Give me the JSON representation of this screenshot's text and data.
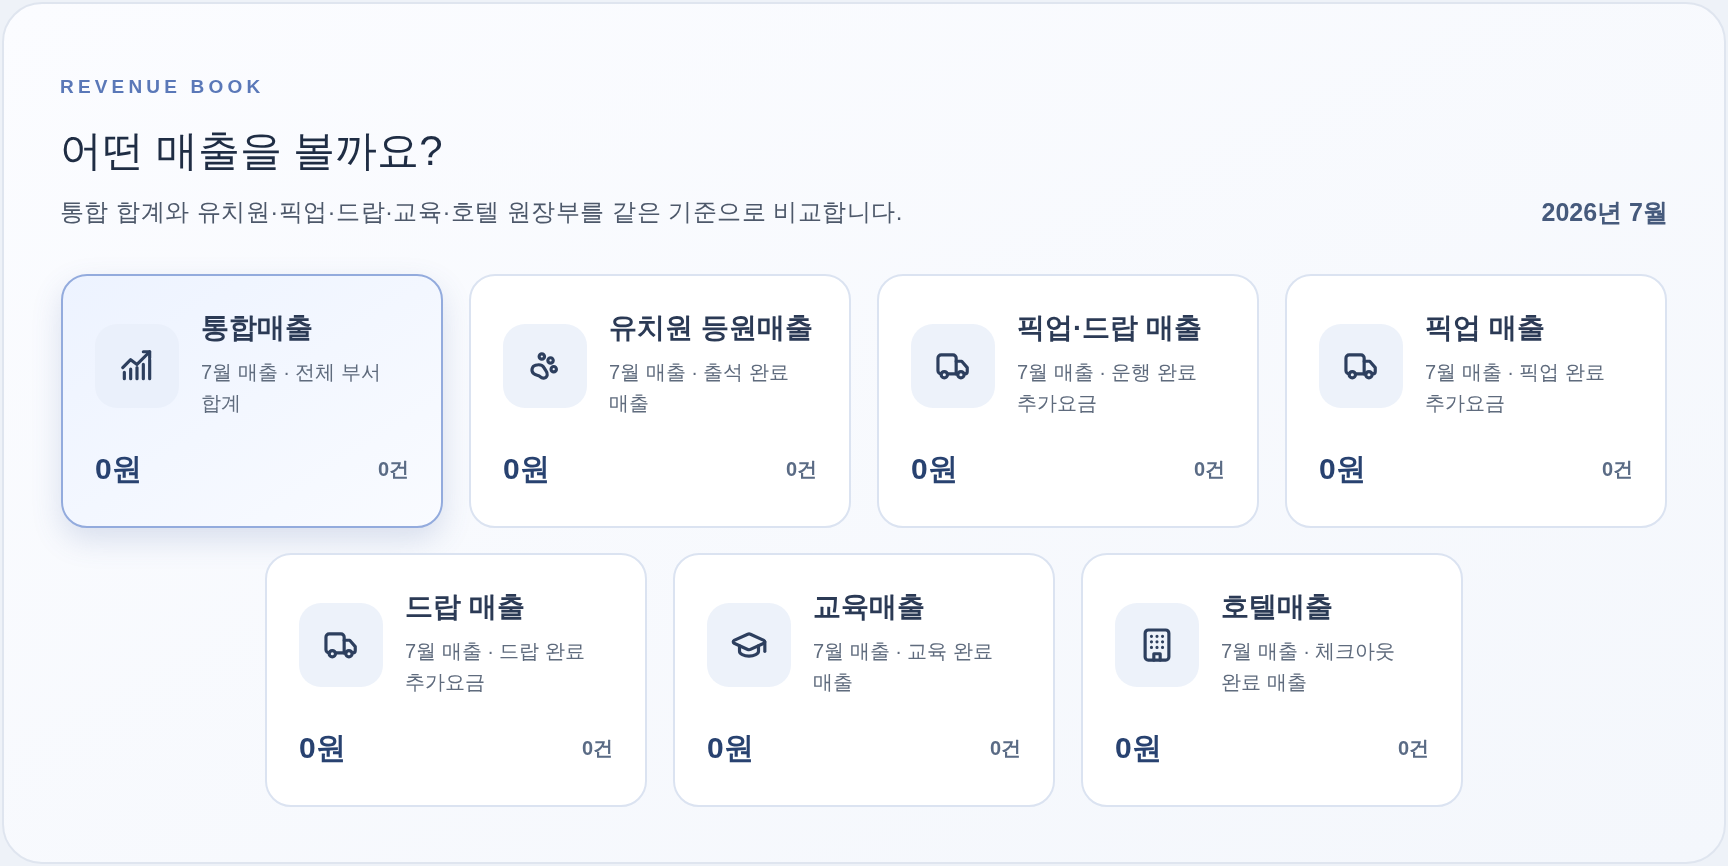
{
  "header": {
    "eyebrow": "REVENUE BOOK",
    "title": "어떤 매출을 볼까요?",
    "description": "통합 합계와 유치원·픽업·드랍·교육·호텔 원장부를 같은 기준으로 비교합니다.",
    "period": "2026년 7월"
  },
  "cards": [
    {
      "kind": "chart",
      "title": "통합매출",
      "subtitle": "7월 매출 · 전체 부서 합계",
      "amount": "0원",
      "count": "0건",
      "selected": true
    },
    {
      "kind": "paw",
      "title": "유치원 등원매출",
      "subtitle": "7월 매출 · 출석 완료 매출",
      "amount": "0원",
      "count": "0건",
      "selected": false
    },
    {
      "kind": "truck",
      "title": "픽업·드랍 매출",
      "subtitle": "7월 매출 · 운행 완료 추가요금",
      "amount": "0원",
      "count": "0건",
      "selected": false
    },
    {
      "kind": "truck",
      "title": "픽업 매출",
      "subtitle": "7월 매출 · 픽업 완료 추가요금",
      "amount": "0원",
      "count": "0건",
      "selected": false
    },
    {
      "kind": "truck",
      "title": "드랍 매출",
      "subtitle": "7월 매출 · 드랍 완료 추가요금",
      "amount": "0원",
      "count": "0건",
      "selected": false
    },
    {
      "kind": "cap",
      "title": "교육매출",
      "subtitle": "7월 매출 · 교육 완료 매출",
      "amount": "0원",
      "count": "0건",
      "selected": false
    },
    {
      "kind": "building",
      "title": "호텔매출",
      "subtitle": "7월 매출 · 체크아웃 완료 매출",
      "amount": "0원",
      "count": "0건",
      "selected": false
    }
  ]
}
